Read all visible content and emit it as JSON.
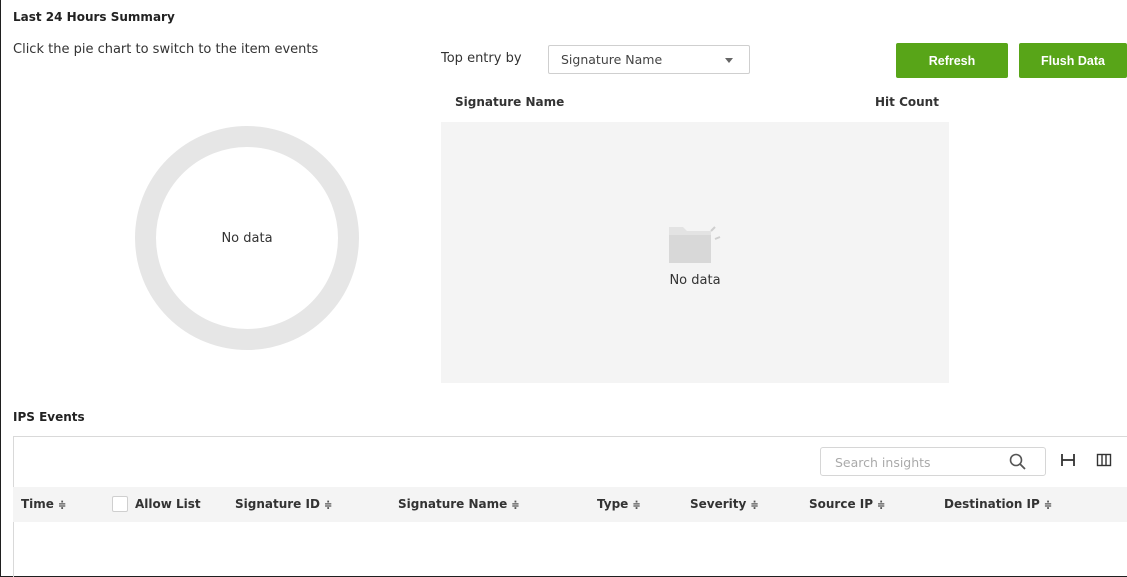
{
  "summary": {
    "title": "Last 24 Hours Summary",
    "hint": "Click the pie chart to switch to the item events",
    "donut_empty": "No data",
    "top_entry_label": "Top entry by",
    "top_entry_value": "Signature Name",
    "refresh_label": "Refresh",
    "flush_label": "Flush Data",
    "col_signature_name": "Signature Name",
    "col_hit_count": "Hit Count",
    "table_empty": "No data"
  },
  "events": {
    "title": "IPS Events",
    "search_placeholder": "Search insights",
    "columns": {
      "time": "Time",
      "allow_list": "Allow List",
      "signature_id": "Signature ID",
      "signature_name": "Signature Name",
      "type": "Type",
      "severity": "Severity",
      "source_ip": "Source IP",
      "destination_ip": "Destination IP"
    },
    "sort_glyph": "≑"
  },
  "colors": {
    "accent_green": "#58a518",
    "empty_gray": "#e6e6e6",
    "panel_bg": "#f4f4f4"
  },
  "icons": [
    "chevron-down-icon",
    "empty-folder-icon",
    "search-icon",
    "fit-width-icon",
    "columns-icon",
    "sort-icon"
  ]
}
